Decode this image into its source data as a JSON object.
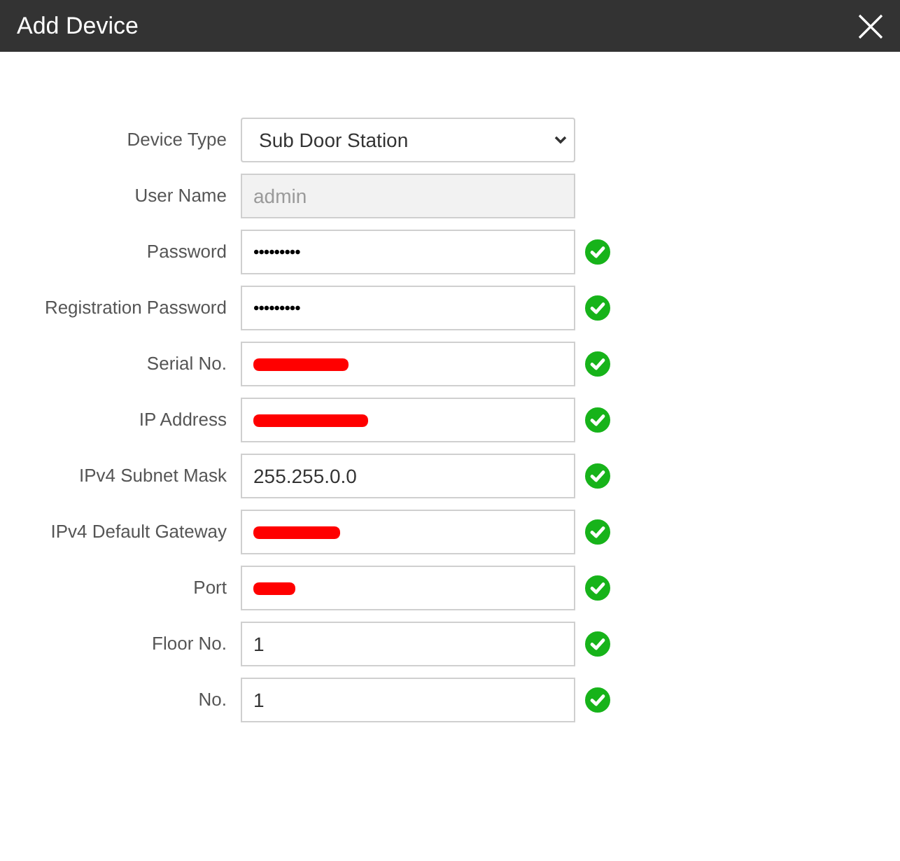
{
  "window": {
    "title": "Add Device"
  },
  "fields": [
    {
      "kind": "select",
      "label": "Device Type",
      "value": "Sub Door Station",
      "disabled": false,
      "valid": false
    },
    {
      "kind": "text",
      "label": "User Name",
      "value": "admin",
      "disabled": true,
      "valid": false
    },
    {
      "kind": "password",
      "label": "Password",
      "value": "•••••••••",
      "disabled": false,
      "valid": true
    },
    {
      "kind": "password",
      "label": "Registration Password",
      "value": "•••••••••",
      "disabled": false,
      "valid": true
    },
    {
      "kind": "redacted",
      "label": "Serial No.",
      "disabled": false,
      "valid": true
    },
    {
      "kind": "redacted",
      "label": "IP Address",
      "disabled": false,
      "valid": true
    },
    {
      "kind": "text",
      "label": "IPv4 Subnet Mask",
      "value": "255.255.0.0",
      "disabled": false,
      "valid": true
    },
    {
      "kind": "redacted",
      "label": "IPv4 Default Gateway",
      "disabled": false,
      "valid": true
    },
    {
      "kind": "redacted",
      "label": "Port",
      "disabled": false,
      "valid": true
    },
    {
      "kind": "text",
      "label": "Floor No.",
      "value": "1",
      "disabled": false,
      "valid": true
    },
    {
      "kind": "text",
      "label": "No.",
      "value": "1",
      "disabled": false,
      "valid": true
    }
  ]
}
